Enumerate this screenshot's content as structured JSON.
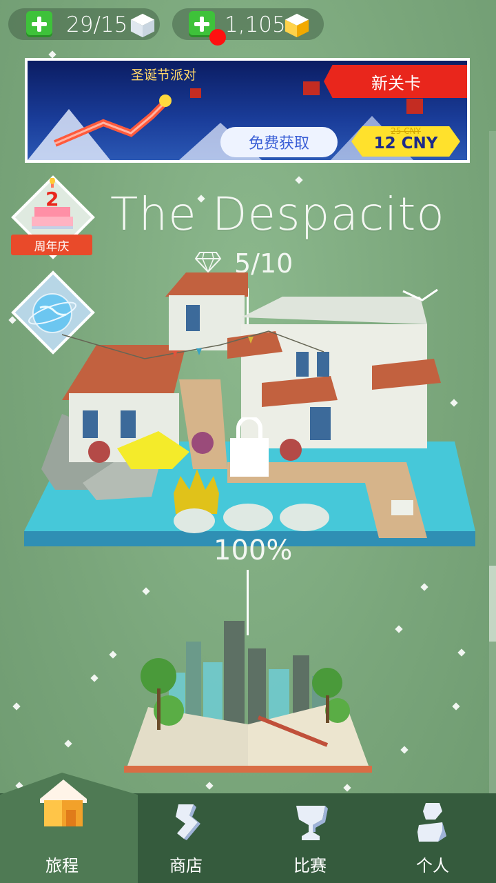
{
  "resources": {
    "cubes": "29/15",
    "gems": "1,105"
  },
  "banner": {
    "title": "圣诞节派对",
    "new_level": "新关卡",
    "free_button": "免费获取",
    "old_price": "25 CNY",
    "price": "12 CNY"
  },
  "event_badge": {
    "label": "周年庆"
  },
  "level": {
    "title": "The Despacito",
    "diamonds": "5/10",
    "progress": "100%",
    "progress_value": 1.0
  },
  "tabs": [
    {
      "label": "旅程",
      "icon": "house-icon"
    },
    {
      "label": "商店",
      "icon": "shop-icon"
    },
    {
      "label": "比赛",
      "icon": "trophy-icon"
    },
    {
      "label": "个人",
      "icon": "person-icon"
    }
  ],
  "colors": {
    "background": "#79a77c",
    "tabbar": "#355b3d",
    "accent_red": "#e94a2a",
    "plus_green": "#3ec23a",
    "price_yellow": "#ffe12c"
  }
}
